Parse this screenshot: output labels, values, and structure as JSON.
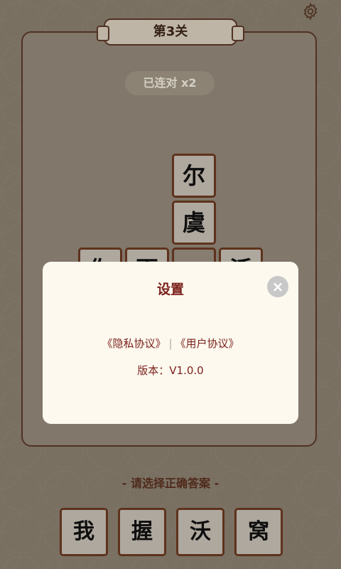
{
  "header": {
    "level_title": "第3关"
  },
  "board": {
    "streak": "已连对 x2",
    "tiles": {
      "t1": "尔",
      "t2": "虞",
      "t3": "你",
      "t4": "更",
      "t5": "",
      "t6": "活"
    }
  },
  "settings_modal": {
    "title": "设置",
    "close_icon": "×",
    "privacy_link": "《隐私协议》",
    "separator": "|",
    "user_link": "《用户协议》",
    "version": "版本：V1.0.0"
  },
  "prompt": "- 请选择正确答案 -",
  "answers": [
    "我",
    "握",
    "沃",
    "窝"
  ],
  "colors": {
    "accent": "#7a1f1a",
    "tile_border": "#6b3a22",
    "board_bg": "#938879"
  },
  "icons": {
    "settings": "gear-icon",
    "close": "close-icon"
  }
}
